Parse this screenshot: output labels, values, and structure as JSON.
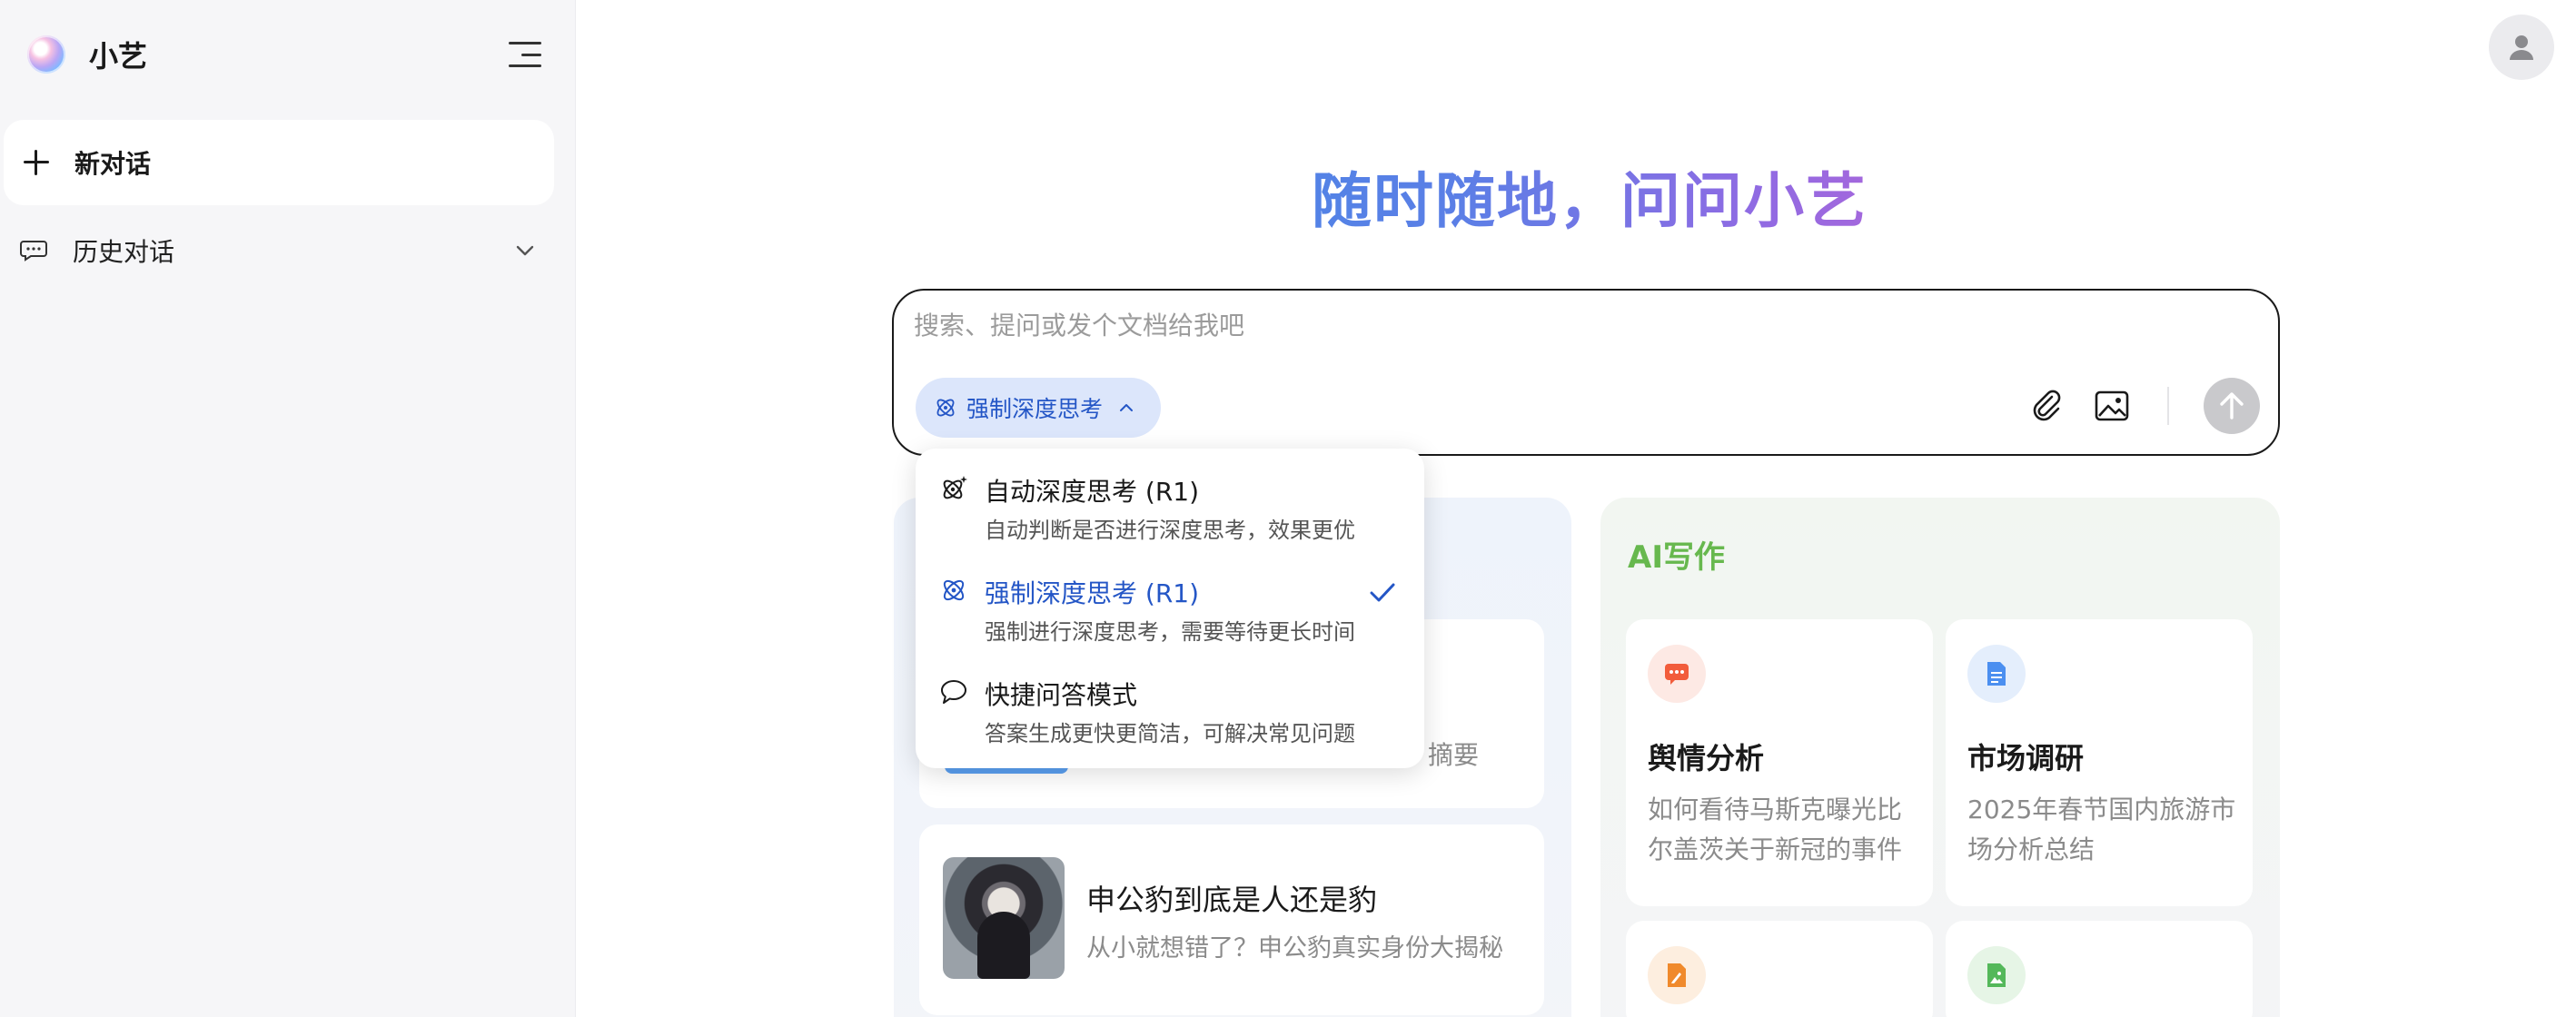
{
  "sidebar": {
    "app_name": "小艺",
    "new_chat_label": "新对话",
    "history_label": "历史对话"
  },
  "main": {
    "hero_title": "随时随地，问问小艺",
    "input": {
      "placeholder": "搜索、提问或发个文档给我吧",
      "value": ""
    },
    "mode_chip_label": "强制深度思考"
  },
  "dropdown": {
    "options": [
      {
        "title": "自动深度思考 (R1)",
        "desc": "自动判断是否进行深度思考，效果更优",
        "selected": false
      },
      {
        "title": "强制深度思考 (R1)",
        "desc": "强制进行深度思考，需要等待更长时间",
        "selected": true
      },
      {
        "title": "快捷问答模式",
        "desc": "答案生成更快更简洁，可解决常见问题",
        "selected": false
      }
    ]
  },
  "left_panel": {
    "card1_tail": "摘要",
    "card2": {
      "title": "申公豹到底是人还是豹",
      "subtitle": "从小就想错了？申公豹真实身份大揭秘"
    }
  },
  "right_panel": {
    "title": "AI写作",
    "cards": [
      {
        "title": "舆情分析",
        "subtitle": "如何看待马斯克曝光比尔盖茨关于新冠的事件",
        "icon": "chat-dots-icon",
        "color": "#f25c3b"
      },
      {
        "title": "市场调研",
        "subtitle": "2025年春节国内旅游市场分析总结",
        "icon": "document-icon",
        "color": "#4b8ff0"
      },
      {
        "title": "",
        "subtitle": "",
        "icon": "edit-document-icon",
        "color": "#f08a2c"
      },
      {
        "title": "",
        "subtitle": "",
        "icon": "image-document-icon",
        "color": "#54b85a"
      }
    ]
  },
  "colors": {
    "accent": "#2456c6",
    "writing_green": "#67b84e"
  }
}
